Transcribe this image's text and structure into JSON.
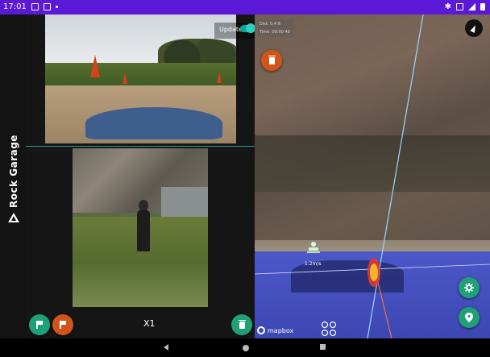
{
  "status_bar": {
    "time": "17:01",
    "left_icons": [
      "gmail-icon",
      "sim-icon",
      "dot-icon"
    ],
    "right_icons": [
      "bluetooth-icon",
      "data-icon",
      "signal-icon",
      "battery-icon"
    ]
  },
  "brand": {
    "name": "Rock Garage",
    "logo": "rock-garage-logo-icon"
  },
  "video": {
    "update_label": "Update",
    "update_enabled": true
  },
  "controls": {
    "zoom_label": "X1",
    "flag_green_icon": "flag-icon",
    "flag_orange_icon": "flag-icon",
    "delete_icon": "trash-icon"
  },
  "map": {
    "info_line1": "Dist: 0.4 ft",
    "info_line2": "Time: 00:00:40",
    "attribution": "mapbox",
    "compass_icon": "compass-icon",
    "delete_icon": "trash-icon",
    "settings_icon": "gear-icon",
    "location_icon": "location-pin-icon",
    "drone_label": "1.2m/s",
    "colors": {
      "accent": "#1fa077",
      "alert": "#d1551b"
    }
  },
  "navigation": {
    "back_icon": "back-icon",
    "home_icon": "home-icon",
    "recents_icon": "recents-icon"
  }
}
